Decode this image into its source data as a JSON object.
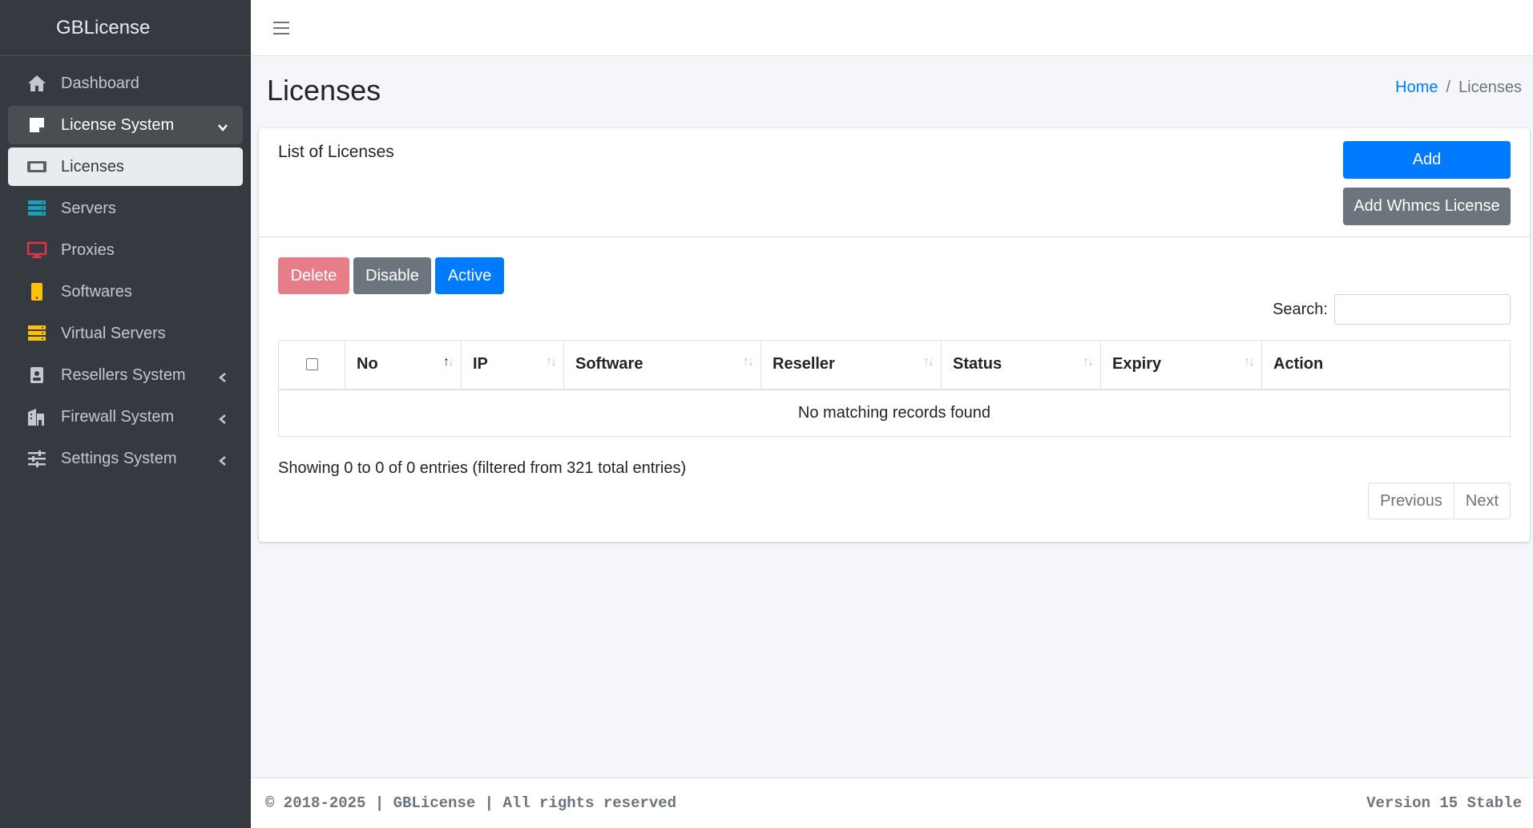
{
  "brand": "GBLicense",
  "sidebar": {
    "items": [
      {
        "label": "Dashboard",
        "icon": "home-icon"
      },
      {
        "label": "License System",
        "icon": "sticky-note-icon"
      },
      {
        "label": "Licenses",
        "icon": "ticket-icon"
      },
      {
        "label": "Servers",
        "icon": "server-icon"
      },
      {
        "label": "Proxies",
        "icon": "desktop-icon"
      },
      {
        "label": "Softwares",
        "icon": "mobile-icon"
      },
      {
        "label": "Virtual Servers",
        "icon": "server-stack-icon"
      },
      {
        "label": "Resellers System",
        "icon": "id-badge-icon"
      },
      {
        "label": "Firewall System",
        "icon": "building-icon"
      },
      {
        "label": "Settings System",
        "icon": "sliders-icon"
      }
    ]
  },
  "header": {
    "title": "Licenses",
    "breadcrumb": {
      "home": "Home",
      "separator": "/",
      "current": "Licenses"
    }
  },
  "card": {
    "title": "List of Licenses",
    "add_label": "Add",
    "add_whmcs_label": "Add Whmcs License",
    "delete_label": "Delete",
    "disable_label": "Disable",
    "active_label": "Active",
    "search_label": "Search:",
    "search_value": ""
  },
  "table": {
    "columns": [
      "No",
      "IP",
      "Software",
      "Reseller",
      "Status",
      "Expiry",
      "Action"
    ],
    "empty_message": "No matching records found",
    "info": "Showing 0 to 0 of 0 entries (filtered from 321 total entries)"
  },
  "pagination": {
    "previous": "Previous",
    "next": "Next"
  },
  "footer": {
    "left": "© 2018-2025 | GBLicense | All rights reserved",
    "right": "Version 15 Stable"
  },
  "colors": {
    "primary": "#007bff",
    "secondary": "#6c757d",
    "danger_faded": "#e77d88",
    "sidebar_bg": "#343a40",
    "servers_icon": "#17a2b8",
    "proxies_icon": "#dc3545",
    "softwares_icon": "#ffc107"
  }
}
